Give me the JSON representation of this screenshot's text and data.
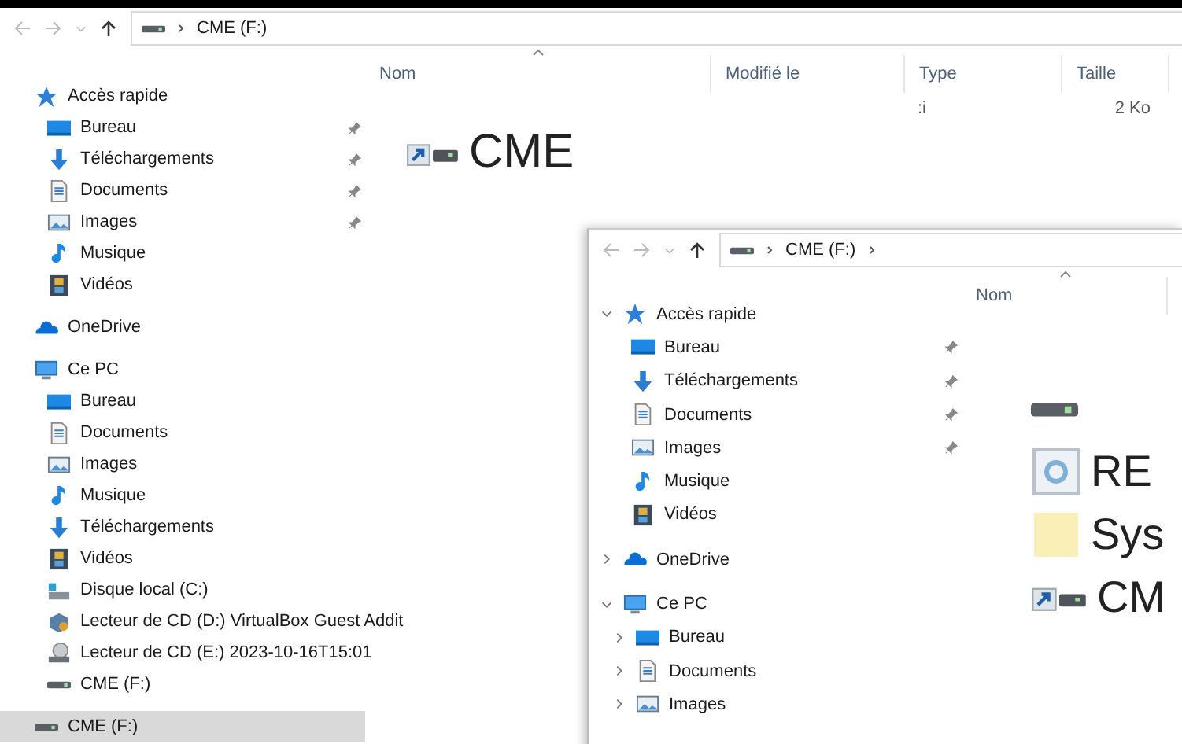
{
  "outer_window": {
    "address": {
      "segments": [
        "CME (F:)"
      ],
      "trailing_chevron": false
    },
    "nav": [
      {
        "label": "Accès rapide",
        "kind": "star",
        "selected": false,
        "children": [
          {
            "label": "Bureau",
            "kind": "desktop",
            "pinned": true,
            "selected": false
          },
          {
            "label": "Téléchargements",
            "kind": "download",
            "pinned": true,
            "selected": false
          },
          {
            "label": "Documents",
            "kind": "documents",
            "pinned": true,
            "selected": false
          },
          {
            "label": "Images",
            "kind": "pictures",
            "pinned": true,
            "selected": false
          },
          {
            "label": "Musique",
            "kind": "music",
            "pinned": false,
            "selected": false
          },
          {
            "label": "Vidéos",
            "kind": "videos",
            "pinned": false,
            "selected": false
          }
        ]
      },
      {
        "label": "OneDrive",
        "kind": "cloud",
        "selected": false
      },
      {
        "label": "Ce PC",
        "kind": "pc",
        "selected": false,
        "children": [
          {
            "label": "Bureau",
            "kind": "desktop",
            "selected": false
          },
          {
            "label": "Documents",
            "kind": "documents",
            "selected": false
          },
          {
            "label": "Images",
            "kind": "pictures",
            "selected": false
          },
          {
            "label": "Musique",
            "kind": "music",
            "selected": false
          },
          {
            "label": "Téléchargements",
            "kind": "download",
            "selected": false
          },
          {
            "label": "Vidéos",
            "kind": "videos",
            "selected": false
          },
          {
            "label": "Disque local (C:)",
            "kind": "disk",
            "selected": false
          },
          {
            "label": "Lecteur de CD (D:) VirtualBox Guest Addit",
            "kind": "cd-box",
            "selected": false
          },
          {
            "label": "Lecteur de CD (E:) 2023-10-16T15:01",
            "kind": "cd",
            "selected": false
          },
          {
            "label": "CME (F:)",
            "kind": "drive",
            "selected": false
          }
        ]
      },
      {
        "label": "CME (F:)",
        "kind": "drive",
        "selected": true
      }
    ],
    "columns": [
      {
        "label": "Nom",
        "sorted": true
      },
      {
        "label": "Modifié le",
        "sorted": false
      },
      {
        "label": "Type",
        "sorted": false
      },
      {
        "label": "Taille",
        "sorted": false
      }
    ],
    "rows": [
      {
        "type": ":i",
        "size": "2 Ko"
      }
    ],
    "large_items": [
      {
        "kind": "shortcut",
        "label": "CME"
      }
    ]
  },
  "inner_window": {
    "address": {
      "segments": [
        "CME (F:)"
      ],
      "trailing_chevron": true
    },
    "nav": [
      {
        "label": "Accès rapide",
        "kind": "star",
        "expanded": true,
        "children": [
          {
            "label": "Bureau",
            "kind": "desktop",
            "pinned": true
          },
          {
            "label": "Téléchargements",
            "kind": "download",
            "pinned": true
          },
          {
            "label": "Documents",
            "kind": "documents",
            "pinned": true
          },
          {
            "label": "Images",
            "kind": "pictures",
            "pinned": true
          },
          {
            "label": "Musique",
            "kind": "music",
            "pinned": false
          },
          {
            "label": "Vidéos",
            "kind": "videos",
            "pinned": false
          }
        ]
      },
      {
        "label": "OneDrive",
        "kind": "cloud",
        "expanded": false
      },
      {
        "label": "Ce PC",
        "kind": "pc",
        "expanded": true,
        "children": [
          {
            "label": "Bureau",
            "kind": "desktop",
            "expanded": false
          },
          {
            "label": "Documents",
            "kind": "documents",
            "expanded": false
          },
          {
            "label": "Images",
            "kind": "pictures",
            "expanded": false
          }
        ]
      }
    ],
    "columns": [
      {
        "label": "Nom",
        "sorted": true
      }
    ],
    "large_items": [
      {
        "kind": "drive"
      },
      {
        "kind": "recycle",
        "label": "RE"
      },
      {
        "kind": "folder",
        "label": "Sys"
      },
      {
        "kind": "shortcut",
        "label": "CM"
      }
    ]
  }
}
